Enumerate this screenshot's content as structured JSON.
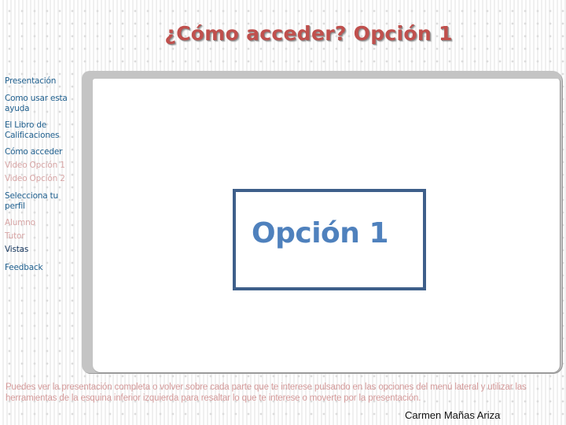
{
  "header": {
    "title": "¿Cómo acceder? Opción 1"
  },
  "sidebar": {
    "items": [
      {
        "label": "Presentación",
        "style": "section"
      },
      {
        "label": "Como usar esta ayuda",
        "style": "section"
      },
      {
        "label": "El Libro de Calificaciones",
        "style": "section"
      },
      {
        "label": "Cómo acceder",
        "style": "section"
      },
      {
        "label": "Video Opción 1",
        "style": "subitem"
      },
      {
        "label": "Video Opción 2",
        "style": "subitem"
      },
      {
        "label": "Selecciona tu perfil",
        "style": "section"
      },
      {
        "label": "Alumno",
        "style": "subitem"
      },
      {
        "label": "Tutor",
        "style": "subitem"
      },
      {
        "label": "Vistas",
        "style": "section-dark"
      },
      {
        "label": "Feedback",
        "style": "section"
      }
    ]
  },
  "main": {
    "option_box_label": "Opción 1"
  },
  "footer": {
    "description": "Puedes ver la presentación completa o volver sobre cada parte que te interese pulsando en las opciones del menú lateral y utilizar las herramientas de la esquina inferior izquierda para resaltar lo que te interese o moverte por la presentación.",
    "author": "Carmen Mañas Ariza"
  },
  "colors": {
    "title": "#c0504d",
    "nav_section": "#1f5f8e",
    "nav_subitem": "#d7a5a5",
    "nav_dark": "#17375e",
    "option_border": "#3e5f8a",
    "option_text": "#4f81bd",
    "description": "#d49a9a"
  }
}
